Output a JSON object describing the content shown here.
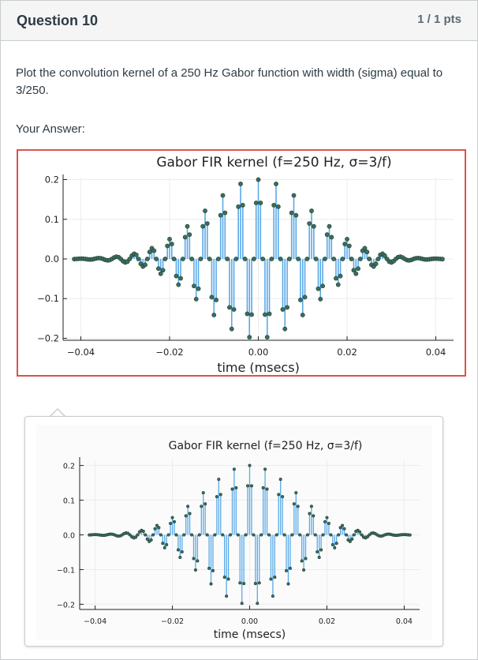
{
  "question": {
    "title": "Question 10",
    "points": "1 / 1 pts",
    "text": "Plot the convolution kernel of a 250 Hz Gabor function with width (sigma) equal to 3/250.",
    "your_answer_label": "Your Answer:"
  },
  "colors": {
    "stem": "#5aa9e6",
    "marker": "#3b6f5a",
    "answer_border": "#d9534f"
  },
  "chart_data": [
    {
      "type": "stem",
      "title": "Gabor FIR kernel (f=250 Hz, σ=3/f)",
      "xlabel": "time (msecs)",
      "ylabel": "",
      "xlim": [
        -0.044,
        0.044
      ],
      "ylim": [
        -0.205,
        0.205
      ],
      "xticks": [
        "−0.04",
        "−0.02",
        "0.00",
        "0.02",
        "0.04"
      ],
      "xtick_values": [
        -0.04,
        -0.02,
        0.0,
        0.02,
        0.04
      ],
      "yticks": [
        "0.2",
        "0.1",
        "0.0",
        "−0.1",
        "−0.2"
      ],
      "ytick_values": [
        0.2,
        0.1,
        0.0,
        -0.1,
        -0.2
      ],
      "grid": true,
      "function": {
        "amplitude": 0.2,
        "frequency_hz": 250,
        "sigma": 0.012,
        "sample_step": 0.0005,
        "range": [
          -0.0415,
          0.0415
        ]
      }
    },
    {
      "type": "stem",
      "title": "Gabor FIR kernel (f=250 Hz, σ=3/f)",
      "xlabel": "time (msecs)",
      "ylabel": "",
      "xlim": [
        -0.044,
        0.044
      ],
      "ylim": [
        -0.215,
        0.215
      ],
      "xticks": [
        "−0.04",
        "−0.02",
        "0.00",
        "0.02",
        "0.04"
      ],
      "xtick_values": [
        -0.04,
        -0.02,
        0.0,
        0.02,
        0.04
      ],
      "yticks": [
        "0.2",
        "0.1",
        "0.0",
        "−0.1",
        "−0.2"
      ],
      "ytick_values": [
        0.2,
        0.1,
        0.0,
        -0.1,
        -0.2
      ],
      "grid": true,
      "function": {
        "amplitude": 0.2,
        "frequency_hz": 250,
        "sigma": 0.012,
        "sample_step": 0.0005,
        "range": [
          -0.0415,
          0.0415
        ]
      }
    }
  ]
}
